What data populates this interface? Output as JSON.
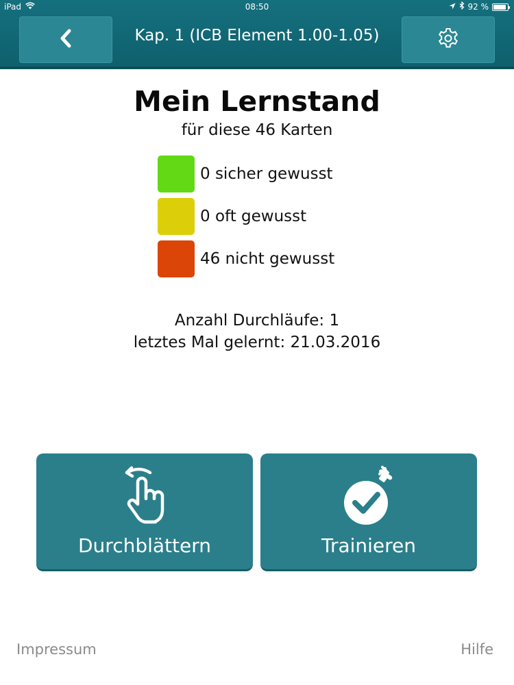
{
  "status_bar": {
    "device": "iPad",
    "time": "08:50",
    "battery": "92 %",
    "battery_level": 0.92,
    "icons": [
      "wifi-icon",
      "location-arrow-icon",
      "bluetooth-icon",
      "battery-icon"
    ]
  },
  "header": {
    "title": "Kap. 1 (ICB Element 1.00-1.05)",
    "back_icon": "chevron-left-icon",
    "settings_icon": "gear-icon"
  },
  "progress": {
    "title": "Mein Lernstand",
    "subtitle": "für diese 46 Karten",
    "legend": [
      {
        "label": "0 sicher gewusst",
        "color": "#62d914"
      },
      {
        "label": "0 oft gewusst",
        "color": "#dccf0a"
      },
      {
        "label": "46 nicht gewusst",
        "color": "#db4508"
      }
    ],
    "runs": "Anzahl Durchläufe: 1",
    "last_learned": "letztes Mal gelernt: 21.03.2016"
  },
  "actions": {
    "browse": {
      "label": "Durchblättern",
      "icon": "swipe-hand-icon"
    },
    "train": {
      "label": "Trainieren",
      "icon": "stopwatch-check-icon"
    }
  },
  "footer": {
    "impressum": "Impressum",
    "help": "Hilfe"
  },
  "colors": {
    "header_bg": "#12687a",
    "button_bg": "#2a7f8b",
    "footer_text": "#8a8a8a"
  }
}
